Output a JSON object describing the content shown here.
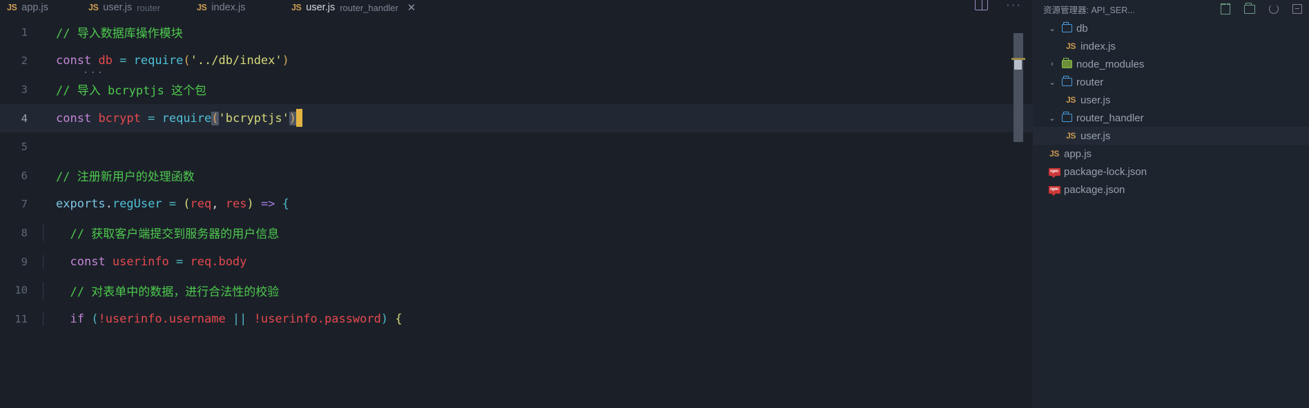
{
  "editor": {
    "tabs": [
      {
        "icon": "js-file-icon",
        "name": "app.js",
        "desc": "",
        "active": false,
        "close": ""
      },
      {
        "icon": "js-file-icon",
        "name": "user.js",
        "desc": "router",
        "active": false,
        "close": ""
      },
      {
        "icon": "js-file-icon",
        "name": "index.js",
        "desc": "",
        "active": false,
        "close": ""
      },
      {
        "icon": "js-file-icon",
        "name": "user.js",
        "desc": "router_handler",
        "active": true,
        "close": "✕"
      }
    ],
    "actions": {
      "split_editor": "split-editor-icon",
      "more_actions": "···"
    },
    "lines": [
      {
        "num": "1",
        "indent": 0,
        "active": false
      },
      {
        "num": "2",
        "indent": 0,
        "active": false
      },
      {
        "num": "3",
        "indent": 0,
        "active": false
      },
      {
        "num": "4",
        "indent": 0,
        "active": true
      },
      {
        "num": "5",
        "indent": 0,
        "active": false
      },
      {
        "num": "6",
        "indent": 0,
        "active": false
      },
      {
        "num": "7",
        "indent": 0,
        "active": false
      },
      {
        "num": "8",
        "indent": 1,
        "active": false
      },
      {
        "num": "9",
        "indent": 1,
        "active": false
      },
      {
        "num": "10",
        "indent": 1,
        "active": false
      },
      {
        "num": "11",
        "indent": 1,
        "active": false
      }
    ],
    "code": {
      "l1_comment": "// 导入数据库操作模块",
      "l2_kw": "const",
      "l2_var": "db",
      "l2_eq": "=",
      "l2_fn": "require",
      "l2_open": "(",
      "l2_str": "'../db/index'",
      "l2_close": ")",
      "l2_hint": "···",
      "l3_comment": "// 导入 bcryptjs 这个包",
      "l4_kw": "const",
      "l4_var": "bcrypt",
      "l4_eq": "=",
      "l4_fn": "require",
      "l4_open": "(",
      "l4_str": "'bcryptjs'",
      "l4_close": ")",
      "l6_comment": "// 注册新用户的处理函数",
      "l7_obj": "exports",
      "l7_dot": ".",
      "l7_prop": "regUser",
      "l7_eq": " = ",
      "l7_paren_open": "(",
      "l7_p1": "req",
      "l7_comma": ", ",
      "l7_p2": "res",
      "l7_paren_close": ")",
      "l7_arrow": " => ",
      "l7_brace": "{",
      "l8_comment": "// 获取客户端提交到服务器的用户信息",
      "l9_kw": "const",
      "l9_var": " userinfo",
      "l9_eq": " = ",
      "l9_val": "req.body",
      "l10_comment": "// 对表单中的数据，进行合法性的校验",
      "l11_kw": "if",
      "l11_open": " (",
      "l11_c1": "!userinfo.username",
      "l11_or": " || ",
      "l11_c2": "!userinfo.password",
      "l11_close": ")",
      "l11_brace": " {"
    }
  },
  "sidebar": {
    "title": "资源管理器: API_SER...",
    "actions": {
      "new_file": "new-file-icon",
      "new_folder": "new-folder-icon",
      "refresh": "refresh-icon",
      "collapse": "collapse-all-icon"
    },
    "tree": [
      {
        "chevron": "⌄",
        "icon": "folder",
        "label": "db",
        "indent": 0,
        "selected": false
      },
      {
        "chevron": "",
        "icon": "js",
        "label": "index.js",
        "indent": 1,
        "selected": false
      },
      {
        "chevron": "›",
        "icon": "folder-green",
        "label": "node_modules",
        "indent": 0,
        "selected": false
      },
      {
        "chevron": "⌄",
        "icon": "folder",
        "label": "router",
        "indent": 0,
        "selected": false
      },
      {
        "chevron": "",
        "icon": "js",
        "label": "user.js",
        "indent": 1,
        "selected": false
      },
      {
        "chevron": "⌄",
        "icon": "folder",
        "label": "router_handler",
        "indent": 0,
        "selected": false
      },
      {
        "chevron": "",
        "icon": "js",
        "label": "user.js",
        "indent": 1,
        "selected": true
      },
      {
        "chevron": "",
        "icon": "js",
        "label": "app.js",
        "indent": 0,
        "selected": false
      },
      {
        "chevron": "",
        "icon": "npm",
        "label": "package-lock.json",
        "indent": 0,
        "selected": false
      },
      {
        "chevron": "",
        "icon": "npm",
        "label": "package.json",
        "indent": 0,
        "selected": false
      }
    ]
  },
  "colors": {
    "background": "#1b2028",
    "sidebar_bg": "#1e242e",
    "active_line": "#222833",
    "comment": "#4ec94e",
    "keyword": "#c586d8",
    "variable": "#e8484f",
    "string": "#d7d97a",
    "function": "#4fc1d9",
    "cursor": "#e3b341",
    "js_icon": "#cc9b52",
    "folder_icon": "#4a9ede",
    "npm_icon": "#cb3837"
  }
}
